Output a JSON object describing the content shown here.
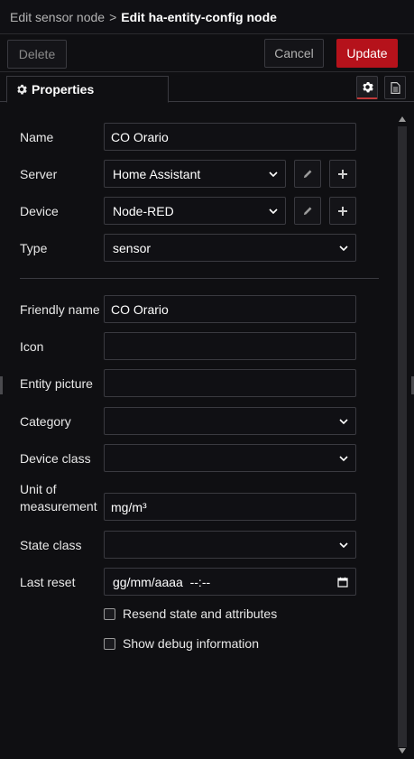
{
  "breadcrumb": {
    "previous": "Edit sensor node",
    "separator": ">",
    "current": "Edit ha-entity-config node"
  },
  "toolbar": {
    "delete_label": "Delete",
    "cancel_label": "Cancel",
    "update_label": "Update"
  },
  "tabs": {
    "properties_label": "Properties"
  },
  "form": {
    "name": {
      "label": "Name",
      "value": "CO Orario"
    },
    "server": {
      "label": "Server",
      "value": "Home Assistant"
    },
    "device": {
      "label": "Device",
      "value": "Node-RED"
    },
    "type": {
      "label": "Type",
      "value": "sensor"
    },
    "friendly_name": {
      "label": "Friendly name",
      "value": "CO Orario"
    },
    "icon": {
      "label": "Icon",
      "value": ""
    },
    "entity_picture": {
      "label": "Entity picture",
      "value": ""
    },
    "category": {
      "label": "Category",
      "value": ""
    },
    "device_class": {
      "label": "Device class",
      "value": ""
    },
    "unit_of_measurement": {
      "label_line1": "Unit of",
      "label_line2": "measurement",
      "value": "mg/m³"
    },
    "state_class": {
      "label": "State class",
      "value": ""
    },
    "last_reset": {
      "label": "Last reset",
      "value": "gg/mm/aaaa  --:--"
    },
    "resend_state": {
      "label": "Resend state and attributes",
      "checked": false
    },
    "show_debug": {
      "label": "Show debug information",
      "checked": false
    }
  },
  "colors": {
    "accent": "#b5121b",
    "background": "#0f0f12"
  }
}
